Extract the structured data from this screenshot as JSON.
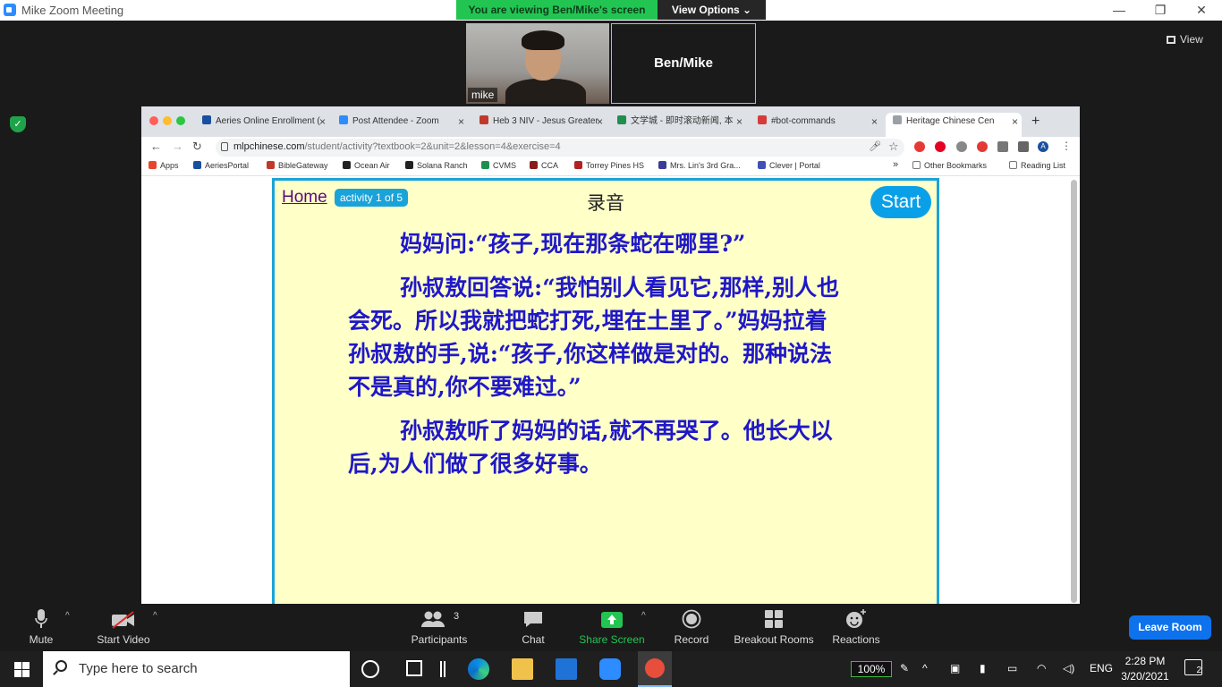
{
  "window": {
    "title": "Mike   Zoom Meeting"
  },
  "banner": {
    "viewing": "You are viewing Ben/Mike's screen",
    "options": "View Options ⌄"
  },
  "tiles": {
    "self_name": "mike",
    "shared_name": "Ben/Mike"
  },
  "view_button": "View",
  "browser": {
    "tabs": [
      {
        "label": "Aeries Online Enrollment (",
        "color": "#1a4fa0"
      },
      {
        "label": "Post Attendee - Zoom",
        "color": "#2d8cff"
      },
      {
        "label": "Heb 3 NIV - Jesus Greater",
        "color": "#c0392b"
      },
      {
        "label": "文学城 - 即时滚动新闻, 本",
        "color": "#1e8f4e"
      },
      {
        "label": "#bot-commands",
        "color": "#d63b3b"
      },
      {
        "label": "Heritage Chinese Cen",
        "color": "#9aa0a6"
      }
    ],
    "url_domain": "mlpchinese.com",
    "url_path": "/student/activity?textbook=2&unit=2&lesson=4&exercise=4",
    "bookmarks": [
      {
        "label": "Apps",
        "color": "#e8452c"
      },
      {
        "label": "AeriesPortal",
        "color": "#1a4fa0"
      },
      {
        "label": "BibleGateway",
        "color": "#c0392b"
      },
      {
        "label": "Ocean Air",
        "color": "#222222"
      },
      {
        "label": "Solana Ranch",
        "color": "#222222"
      },
      {
        "label": "CVMS",
        "color": "#1e8f4e"
      },
      {
        "label": "CCA",
        "color": "#8b1a1a"
      },
      {
        "label": "Torrey Pines HS",
        "color": "#b22222"
      },
      {
        "label": "Mrs. Lin's 3rd Gra...",
        "color": "#3b3b98"
      },
      {
        "label": "Clever | Portal",
        "color": "#3f51b5"
      }
    ],
    "bookmarks_overflow": "»",
    "other_bookmarks": "Other Bookmarks",
    "reading_list": "Reading List"
  },
  "activity": {
    "home": "Home",
    "badge": "activity 1 of 5",
    "title": "录音",
    "start": "Start",
    "paragraphs": [
      "妈妈问:“孩子,现在那条蛇在哪里?”",
      "孙叔敖回答说:“我怕别人看见它,那样,别人也会死。所以我就把蛇打死,埋在土里了。”妈妈拉着孙叔敖的手,说:“孩子,你这样做是对的。那种说法不是真的,你不要难过。”",
      "孙叔敖听了妈妈的话,就不再哭了。他长大以后,为人们做了很多好事。"
    ]
  },
  "toolbar": {
    "mute": "Mute",
    "start_video": "Start Video",
    "participants": "Participants",
    "participants_count": "3",
    "chat": "Chat",
    "share_screen": "Share Screen",
    "record": "Record",
    "breakout_rooms": "Breakout Rooms",
    "reactions": "Reactions",
    "leave": "Leave Room"
  },
  "taskbar": {
    "search_placeholder": "Type here to search",
    "battery": "100%",
    "language": "ENG",
    "time": "2:28 PM",
    "date": "3/20/2021",
    "notifications": "2"
  }
}
